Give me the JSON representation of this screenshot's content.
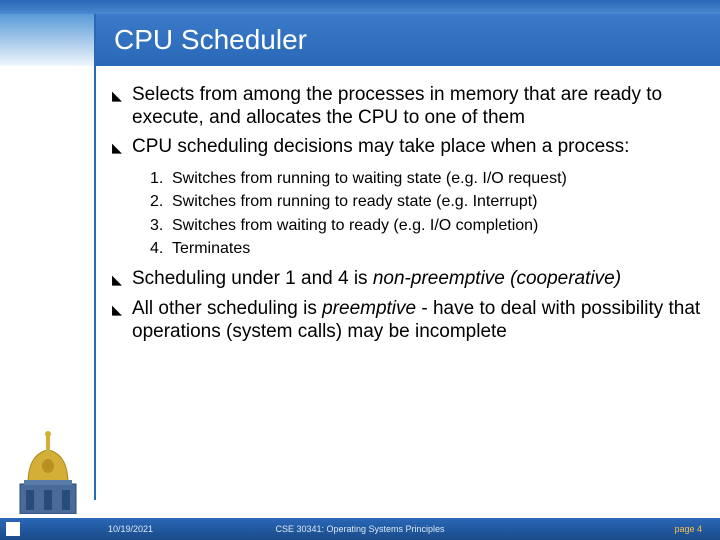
{
  "title": "CPU Scheduler",
  "bullets": [
    "Selects from among the processes in memory that are ready to execute, and allocates the CPU to one of them",
    "CPU scheduling decisions may take place when a process:"
  ],
  "numbered": [
    "Switches from running to waiting state (e.g. I/O request)",
    "Switches from running to ready state (e.g. Interrupt)",
    "Switches from waiting to ready (e.g. I/O completion)",
    "Terminates"
  ],
  "bullets2": {
    "b3_pre": "Scheduling under 1 and 4 is ",
    "b3_em": "non-preemptive (cooperative)",
    "b4_pre": "All other scheduling is ",
    "b4_em": "preemptive",
    "b4_post": " - have to deal with possibility that operations (system calls) may be incomplete"
  },
  "footer": {
    "date": "10/19/2021",
    "course": "CSE 30341: Operating Systems Principles",
    "page": "page 4"
  },
  "colors": {
    "blue": "#2a68b8",
    "gold": "#f5c050"
  }
}
